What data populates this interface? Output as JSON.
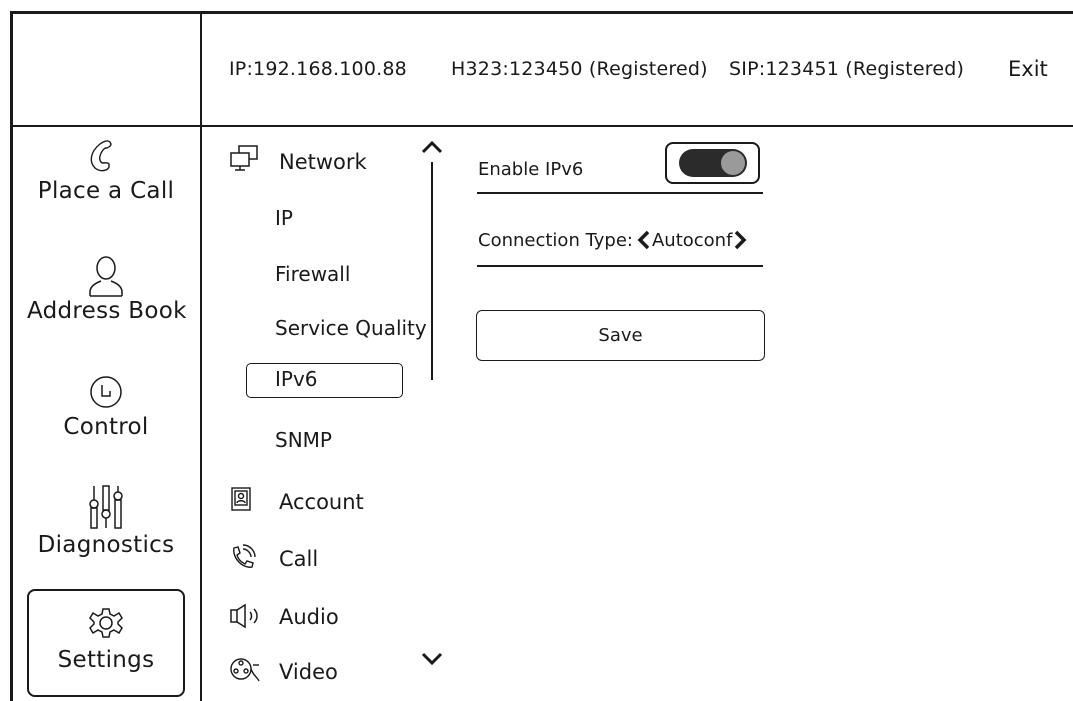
{
  "header": {
    "ip": "IP:192.168.100.88",
    "h323": "H323:123450 (Registered)",
    "sip": "SIP:123451 (Registered)",
    "exit_label": "Exit"
  },
  "nav": {
    "place_call": "Place a Call",
    "address_book": "Address Book",
    "control": "Control",
    "diagnostics": "Diagnostics",
    "settings": "Settings",
    "active": "Settings"
  },
  "tree": {
    "network": "Network",
    "network_children": {
      "ip": "IP",
      "firewall": "Firewall",
      "service_quality": "Service Quality",
      "ipv6": "IPv6",
      "snmp": "SNMP"
    },
    "selected": "IPv6",
    "account": "Account",
    "call": "Call",
    "audio": "Audio",
    "video": "Video"
  },
  "ipv6_settings": {
    "enable_label": "Enable IPv6",
    "enable_on": true,
    "connection_type_label": "Connection Type:",
    "connection_type_value": "Autoconf",
    "save_label": "Save"
  }
}
